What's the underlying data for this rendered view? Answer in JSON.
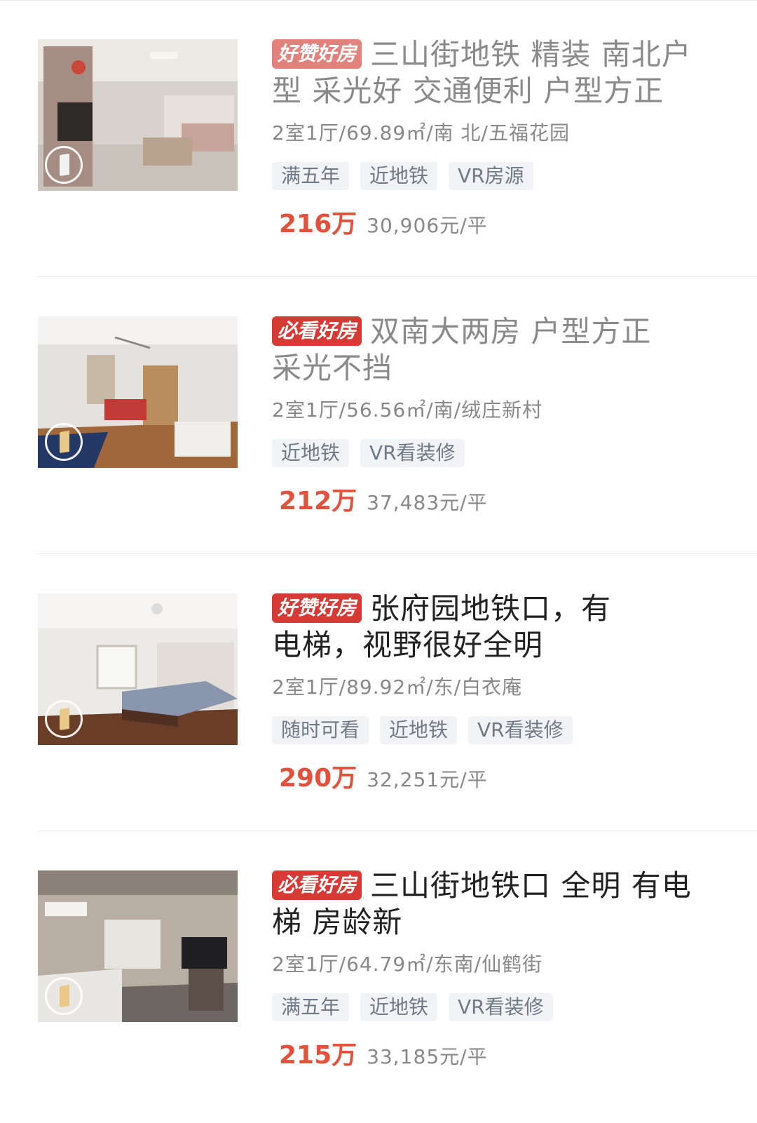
{
  "listings": [
    {
      "badge": "好赞好房",
      "title_line1": "三山街地铁 精装 南北户",
      "title_line2": "型 采光好 交通便利 户型方正",
      "info": "2室1厅/69.89㎡/南 北/五福花园",
      "tags": [
        "满五年",
        "近地铁",
        "VR房源"
      ],
      "price": "216万",
      "unit_price": "30,906元/平"
    },
    {
      "badge": "必看好房",
      "title_line1": "双南大两房  户型方正",
      "title_line2": "采光不挡",
      "info": "2室1厅/56.56㎡/南/绒庄新村",
      "tags": [
        "近地铁",
        "VR看装修"
      ],
      "price": "212万",
      "unit_price": "37,483元/平"
    },
    {
      "badge": "好赞好房",
      "title_line1": "张府园地铁口，有",
      "title_line2": "电梯，视野很好全明",
      "info": "2室1厅/89.92㎡/东/白衣庵",
      "tags": [
        "随时可看",
        "近地铁",
        "VR看装修"
      ],
      "price": "290万",
      "unit_price": "32,251元/平"
    },
    {
      "badge": "必看好房",
      "title_line1": "三山街地铁口 全明 有电",
      "title_line2": "梯 房龄新",
      "info": "2室1厅/64.79㎡/东南/仙鹤街",
      "tags": [
        "满五年",
        "近地铁",
        "VR看装修"
      ],
      "price": "215万",
      "unit_price": "33,185元/平"
    }
  ],
  "colors": {
    "price": "#e2513c",
    "badge": "#d53a34",
    "tag_bg": "#f1f3f7",
    "tag_text": "#6f7a87"
  }
}
